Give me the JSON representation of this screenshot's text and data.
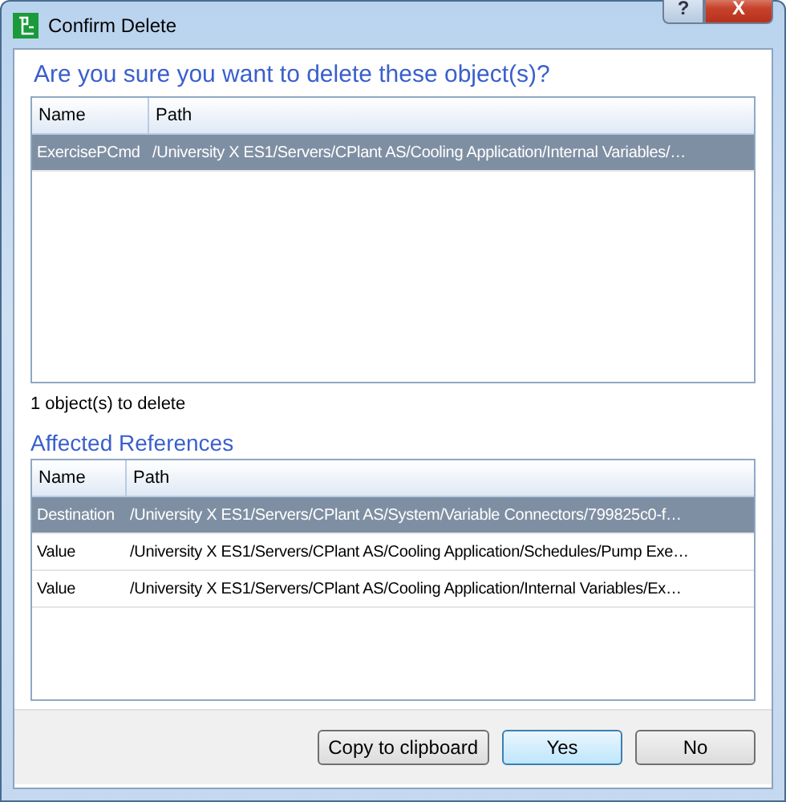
{
  "window": {
    "title": "Confirm Delete",
    "help_button": "?",
    "close_button": "X"
  },
  "heading": "Are you sure you want to delete these object(s)?",
  "objects_table": {
    "columns": [
      "Name",
      "Path"
    ],
    "rows": [
      {
        "name": "ExercisePCmd",
        "path": "/University X ES1/Servers/CPlant AS/Cooling Application/Internal Variables/…",
        "selected": true
      }
    ]
  },
  "count_label": "1 object(s) to delete",
  "references_heading": "Affected References",
  "references_table": {
    "columns": [
      "Name",
      "Path"
    ],
    "rows": [
      {
        "name": "Destination",
        "path": "/University X ES1/Servers/CPlant AS/System/Variable Connectors/799825c0-f…",
        "selected": true
      },
      {
        "name": "Value",
        "path": "/University X ES1/Servers/CPlant AS/Cooling Application/Schedules/Pump Exe…",
        "selected": false
      },
      {
        "name": "Value",
        "path": "/University X ES1/Servers/CPlant AS/Cooling Application/Internal Variables/Ex…",
        "selected": false
      }
    ]
  },
  "buttons": [
    {
      "label": "Copy to clipboard",
      "default": false
    },
    {
      "label": "Yes",
      "default": true
    },
    {
      "label": "No",
      "default": false
    }
  ]
}
